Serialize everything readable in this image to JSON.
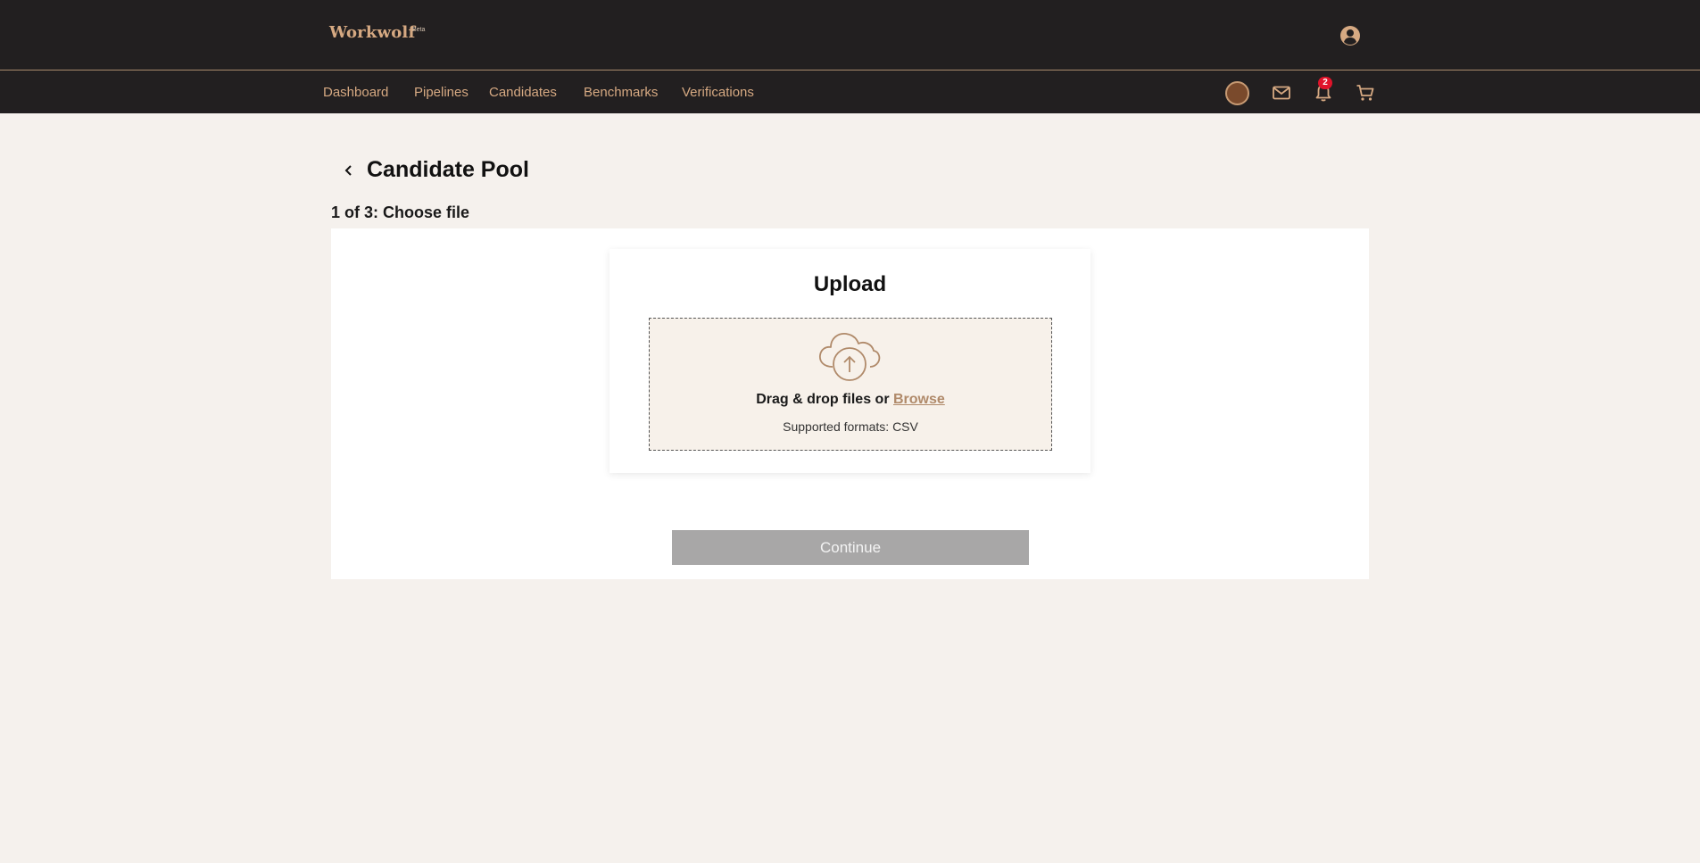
{
  "header": {
    "brand": "Workwolf",
    "brand_tag": "Beta"
  },
  "nav": {
    "items": [
      {
        "label": "Dashboard"
      },
      {
        "label": "Pipelines"
      },
      {
        "label": "Candidates"
      },
      {
        "label": "Benchmarks"
      },
      {
        "label": "Verifications"
      }
    ],
    "notification_count": "2",
    "icons": [
      "avatar",
      "mail-icon",
      "bell-icon",
      "cart-icon"
    ]
  },
  "page": {
    "title": "Candidate Pool",
    "step": "1 of 3: Choose file"
  },
  "upload": {
    "title": "Upload",
    "drop_text": "Drag & drop files or",
    "browse_label": "Browse",
    "formats": "Supported formats: CSV"
  },
  "actions": {
    "continue_label": "Continue"
  },
  "colors": {
    "header_bg": "#221f20",
    "accent": "#d6a982",
    "page_bg": "#f5f1ed",
    "dropzone_bg": "#f7f1ea",
    "badge": "#e0132a",
    "button_disabled": "#a8a7a7"
  }
}
